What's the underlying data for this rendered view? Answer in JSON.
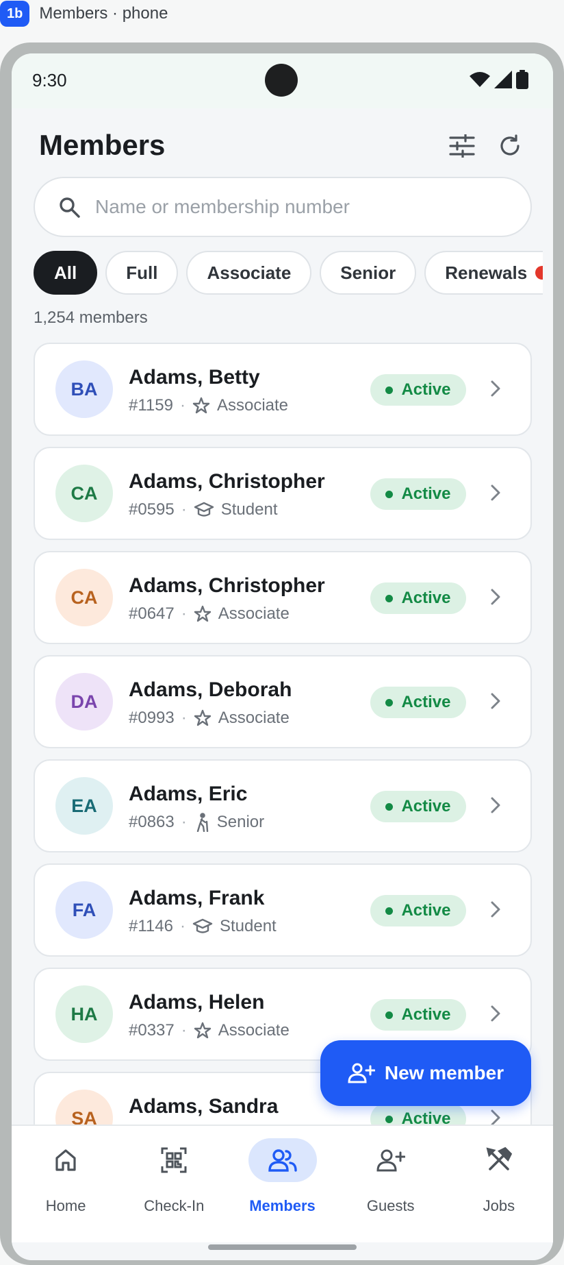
{
  "caption": {
    "badge": "1b",
    "title": "Members · phone"
  },
  "status": {
    "time": "9:30"
  },
  "header": {
    "title": "Members",
    "filter_icon": "sliders-icon",
    "refresh_icon": "refresh-icon"
  },
  "search": {
    "placeholder": "Name or membership number",
    "value": ""
  },
  "chips": [
    {
      "label": "All",
      "active": true
    },
    {
      "label": "Full",
      "active": false
    },
    {
      "label": "Associate",
      "active": false
    },
    {
      "label": "Senior",
      "active": false
    },
    {
      "label": "Renewals",
      "active": false,
      "alert": true
    }
  ],
  "count": "1,254 members",
  "members": [
    {
      "initials": "BA",
      "name": "Adams, Betty",
      "number": "#1159",
      "type": "Associate",
      "type_icon": "star-icon",
      "status": "Active",
      "avatar_bg": "#e1e8fd",
      "avatar_fg": "#2f4fb8"
    },
    {
      "initials": "CA",
      "name": "Adams, Christopher",
      "number": "#0595",
      "type": "Student",
      "type_icon": "graduation-cap-icon",
      "status": "Active",
      "avatar_bg": "#dff2e6",
      "avatar_fg": "#1e7a46"
    },
    {
      "initials": "CA",
      "name": "Adams, Christopher",
      "number": "#0647",
      "type": "Associate",
      "type_icon": "star-icon",
      "status": "Active",
      "avatar_bg": "#fde9dc",
      "avatar_fg": "#b8621f"
    },
    {
      "initials": "DA",
      "name": "Adams, Deborah",
      "number": "#0993",
      "type": "Associate",
      "type_icon": "star-icon",
      "status": "Active",
      "avatar_bg": "#eee3f8",
      "avatar_fg": "#7a45ad"
    },
    {
      "initials": "EA",
      "name": "Adams, Eric",
      "number": "#0863",
      "type": "Senior",
      "type_icon": "walking-icon",
      "status": "Active",
      "avatar_bg": "#dff0f2",
      "avatar_fg": "#196b75"
    },
    {
      "initials": "FA",
      "name": "Adams, Frank",
      "number": "#1146",
      "type": "Student",
      "type_icon": "graduation-cap-icon",
      "status": "Active",
      "avatar_bg": "#e1e8fd",
      "avatar_fg": "#2f4fb8"
    },
    {
      "initials": "HA",
      "name": "Adams, Helen",
      "number": "#0337",
      "type": "Associate",
      "type_icon": "star-icon",
      "status": "Active",
      "avatar_bg": "#dff2e6",
      "avatar_fg": "#1e7a46"
    },
    {
      "initials": "SA",
      "name": "Adams, Sandra",
      "number": "",
      "type": "",
      "type_icon": "",
      "status": "Active",
      "avatar_bg": "#fde9dc",
      "avatar_fg": "#b8621f"
    }
  ],
  "fab": {
    "label": "New member",
    "icon": "add-person-icon"
  },
  "nav": [
    {
      "label": "Home",
      "icon": "home-icon",
      "active": false
    },
    {
      "label": "Check-In",
      "icon": "qr-code-icon",
      "active": false
    },
    {
      "label": "Members",
      "icon": "people-icon",
      "active": true
    },
    {
      "label": "Guests",
      "icon": "add-person-icon",
      "active": false
    },
    {
      "label": "Jobs",
      "icon": "tools-icon",
      "active": false
    }
  ],
  "colors": {
    "accent": "#1f5bf5",
    "active_status": "#138a45",
    "active_status_bg": "#dcf1e4",
    "chip_selected": "#1a1d21"
  }
}
